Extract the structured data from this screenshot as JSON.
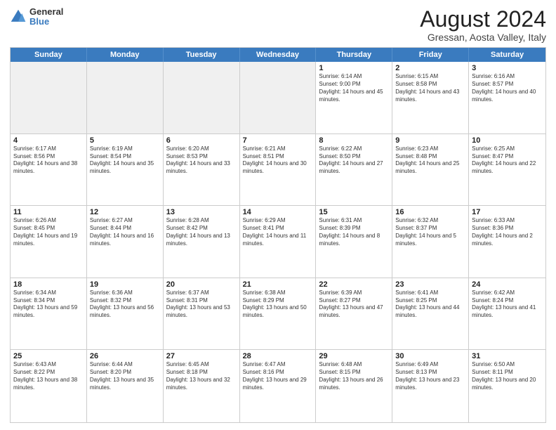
{
  "logo": {
    "general": "General",
    "blue": "Blue"
  },
  "title": "August 2024",
  "subtitle": "Gressan, Aosta Valley, Italy",
  "header_days": [
    "Sunday",
    "Monday",
    "Tuesday",
    "Wednesday",
    "Thursday",
    "Friday",
    "Saturday"
  ],
  "weeks": [
    [
      {
        "day": "",
        "info": "",
        "shaded": true
      },
      {
        "day": "",
        "info": "",
        "shaded": true
      },
      {
        "day": "",
        "info": "",
        "shaded": true
      },
      {
        "day": "",
        "info": "",
        "shaded": true
      },
      {
        "day": "1",
        "info": "Sunrise: 6:14 AM\nSunset: 9:00 PM\nDaylight: 14 hours and 45 minutes."
      },
      {
        "day": "2",
        "info": "Sunrise: 6:15 AM\nSunset: 8:58 PM\nDaylight: 14 hours and 43 minutes."
      },
      {
        "day": "3",
        "info": "Sunrise: 6:16 AM\nSunset: 8:57 PM\nDaylight: 14 hours and 40 minutes."
      }
    ],
    [
      {
        "day": "4",
        "info": "Sunrise: 6:17 AM\nSunset: 8:56 PM\nDaylight: 14 hours and 38 minutes."
      },
      {
        "day": "5",
        "info": "Sunrise: 6:19 AM\nSunset: 8:54 PM\nDaylight: 14 hours and 35 minutes."
      },
      {
        "day": "6",
        "info": "Sunrise: 6:20 AM\nSunset: 8:53 PM\nDaylight: 14 hours and 33 minutes."
      },
      {
        "day": "7",
        "info": "Sunrise: 6:21 AM\nSunset: 8:51 PM\nDaylight: 14 hours and 30 minutes."
      },
      {
        "day": "8",
        "info": "Sunrise: 6:22 AM\nSunset: 8:50 PM\nDaylight: 14 hours and 27 minutes."
      },
      {
        "day": "9",
        "info": "Sunrise: 6:23 AM\nSunset: 8:48 PM\nDaylight: 14 hours and 25 minutes."
      },
      {
        "day": "10",
        "info": "Sunrise: 6:25 AM\nSunset: 8:47 PM\nDaylight: 14 hours and 22 minutes."
      }
    ],
    [
      {
        "day": "11",
        "info": "Sunrise: 6:26 AM\nSunset: 8:45 PM\nDaylight: 14 hours and 19 minutes."
      },
      {
        "day": "12",
        "info": "Sunrise: 6:27 AM\nSunset: 8:44 PM\nDaylight: 14 hours and 16 minutes."
      },
      {
        "day": "13",
        "info": "Sunrise: 6:28 AM\nSunset: 8:42 PM\nDaylight: 14 hours and 13 minutes."
      },
      {
        "day": "14",
        "info": "Sunrise: 6:29 AM\nSunset: 8:41 PM\nDaylight: 14 hours and 11 minutes."
      },
      {
        "day": "15",
        "info": "Sunrise: 6:31 AM\nSunset: 8:39 PM\nDaylight: 14 hours and 8 minutes."
      },
      {
        "day": "16",
        "info": "Sunrise: 6:32 AM\nSunset: 8:37 PM\nDaylight: 14 hours and 5 minutes."
      },
      {
        "day": "17",
        "info": "Sunrise: 6:33 AM\nSunset: 8:36 PM\nDaylight: 14 hours and 2 minutes."
      }
    ],
    [
      {
        "day": "18",
        "info": "Sunrise: 6:34 AM\nSunset: 8:34 PM\nDaylight: 13 hours and 59 minutes."
      },
      {
        "day": "19",
        "info": "Sunrise: 6:36 AM\nSunset: 8:32 PM\nDaylight: 13 hours and 56 minutes."
      },
      {
        "day": "20",
        "info": "Sunrise: 6:37 AM\nSunset: 8:31 PM\nDaylight: 13 hours and 53 minutes."
      },
      {
        "day": "21",
        "info": "Sunrise: 6:38 AM\nSunset: 8:29 PM\nDaylight: 13 hours and 50 minutes."
      },
      {
        "day": "22",
        "info": "Sunrise: 6:39 AM\nSunset: 8:27 PM\nDaylight: 13 hours and 47 minutes."
      },
      {
        "day": "23",
        "info": "Sunrise: 6:41 AM\nSunset: 8:25 PM\nDaylight: 13 hours and 44 minutes."
      },
      {
        "day": "24",
        "info": "Sunrise: 6:42 AM\nSunset: 8:24 PM\nDaylight: 13 hours and 41 minutes."
      }
    ],
    [
      {
        "day": "25",
        "info": "Sunrise: 6:43 AM\nSunset: 8:22 PM\nDaylight: 13 hours and 38 minutes."
      },
      {
        "day": "26",
        "info": "Sunrise: 6:44 AM\nSunset: 8:20 PM\nDaylight: 13 hours and 35 minutes."
      },
      {
        "day": "27",
        "info": "Sunrise: 6:45 AM\nSunset: 8:18 PM\nDaylight: 13 hours and 32 minutes."
      },
      {
        "day": "28",
        "info": "Sunrise: 6:47 AM\nSunset: 8:16 PM\nDaylight: 13 hours and 29 minutes."
      },
      {
        "day": "29",
        "info": "Sunrise: 6:48 AM\nSunset: 8:15 PM\nDaylight: 13 hours and 26 minutes."
      },
      {
        "day": "30",
        "info": "Sunrise: 6:49 AM\nSunset: 8:13 PM\nDaylight: 13 hours and 23 minutes."
      },
      {
        "day": "31",
        "info": "Sunrise: 6:50 AM\nSunset: 8:11 PM\nDaylight: 13 hours and 20 minutes."
      }
    ]
  ]
}
